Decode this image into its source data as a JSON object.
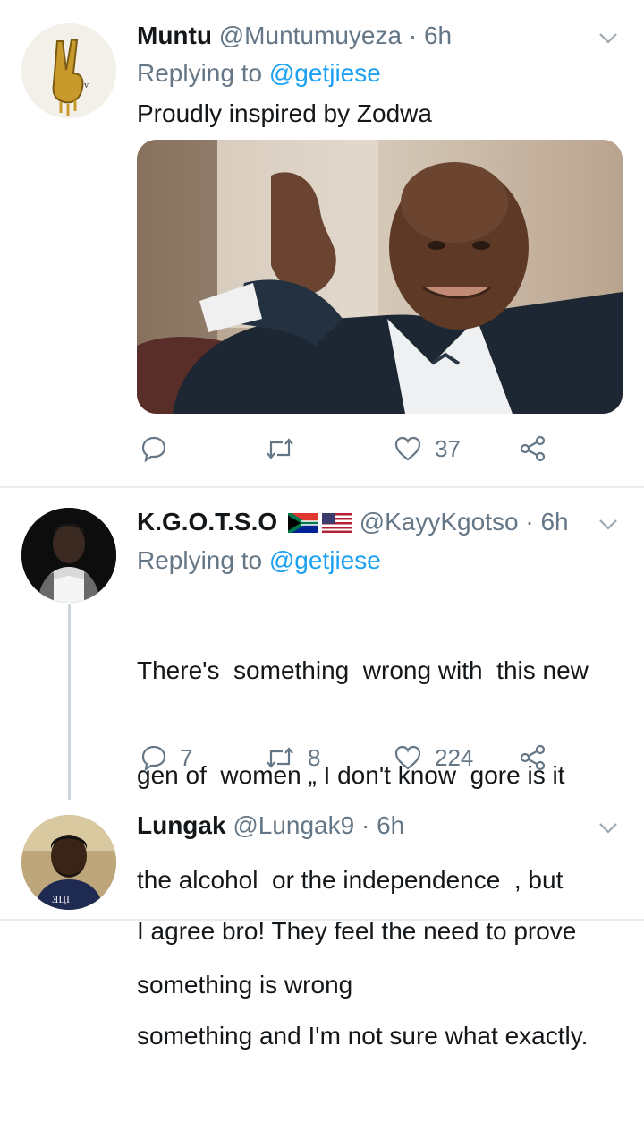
{
  "tweets": [
    {
      "name": "Muntu",
      "handle": "@Muntumuyeza",
      "separator": "·",
      "time": "6h",
      "replying_prefix": "Replying to",
      "replying_to": "@getjiese",
      "text": "Proudly inspired by Zodwa",
      "has_image": true,
      "reply_count": "",
      "retweet_count": "",
      "like_count": "37"
    },
    {
      "name": "K.G.O.T.S.O",
      "handle": "@KayyKgotso",
      "separator": "·",
      "time": "6h",
      "replying_prefix": "Replying to",
      "replying_to": "@getjiese",
      "text_lines": [
        "There's  something  wrong with  this new",
        "gen of  women „ I don't know  gore is it",
        "the alcohol  or the independence  , but",
        "something is wrong"
      ],
      "reply_count": "7",
      "retweet_count": "8",
      "like_count": "224"
    },
    {
      "name": "Lungak",
      "handle": "@Lungak9",
      "separator": "·",
      "time": "6h",
      "text_lines": [
        "I agree bro! They feel the need to prove",
        "something and I'm not sure what exactly."
      ]
    }
  ],
  "icons": {
    "reply": "reply-icon",
    "retweet": "retweet-icon",
    "like": "heart-icon",
    "share": "share-icon",
    "menu": "chevron-down-icon"
  },
  "colors": {
    "link": "#1da1f2",
    "secondary": "#657786",
    "divider": "#e6ecf0"
  }
}
